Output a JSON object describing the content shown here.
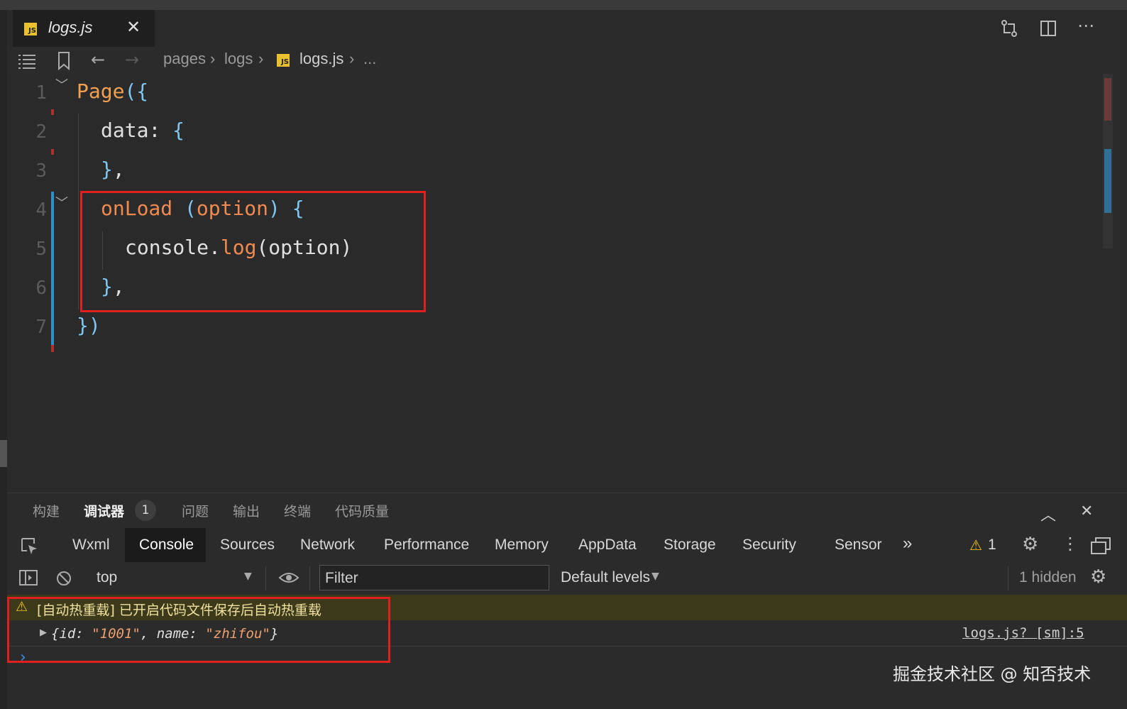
{
  "editor_tab": {
    "title": "logs.js",
    "icon": "JS"
  },
  "breadcrumb": {
    "parts": [
      "pages",
      "logs"
    ],
    "file": "logs.js",
    "ellipsis": "..."
  },
  "line_numbers": [
    "1",
    "2",
    "3",
    "4",
    "5",
    "6",
    "7"
  ],
  "code": {
    "l1_kw": "Page",
    "l1_br": "({",
    "l2_ident": "data",
    "l2_colon": ": ",
    "l2_br": "{",
    "l3_br": "}",
    "l3_comma": ",",
    "l4_fn": "onLoad",
    "l4_paren_open": " (",
    "l4_param": "option",
    "l4_paren_close": ") ",
    "l4_br": "{",
    "l5_obj": "console.",
    "l5_fn": "log",
    "l5_args": "(option)",
    "l6_br": "}",
    "l6_comma": ",",
    "l7_br": "})"
  },
  "bottom_panel": {
    "tabs": [
      "构建",
      "调试器",
      "问题",
      "输出",
      "终端",
      "代码质量"
    ],
    "debugger_badge": "1"
  },
  "devtools": {
    "tabs": [
      "Wxml",
      "Console",
      "Sources",
      "Network",
      "Performance",
      "Memory",
      "AppData",
      "Storage",
      "Security",
      "Sensor"
    ],
    "more": "»",
    "warning_count": "1"
  },
  "console_toolbar": {
    "context": "top",
    "filter_placeholder": "Filter",
    "levels": "Default levels",
    "hidden": "1 hidden"
  },
  "console": {
    "warning": "[自动热重载] 已开启代码文件保存后自动热重载",
    "log_open": "{id: ",
    "log_id": "\"1001\"",
    "log_mid": ", name: ",
    "log_name": "\"zhifou\"",
    "log_close": "}",
    "source": "logs.js? [sm]:5",
    "prompt": "›"
  },
  "watermark": "掘金技术社区 @ 知否技术"
}
